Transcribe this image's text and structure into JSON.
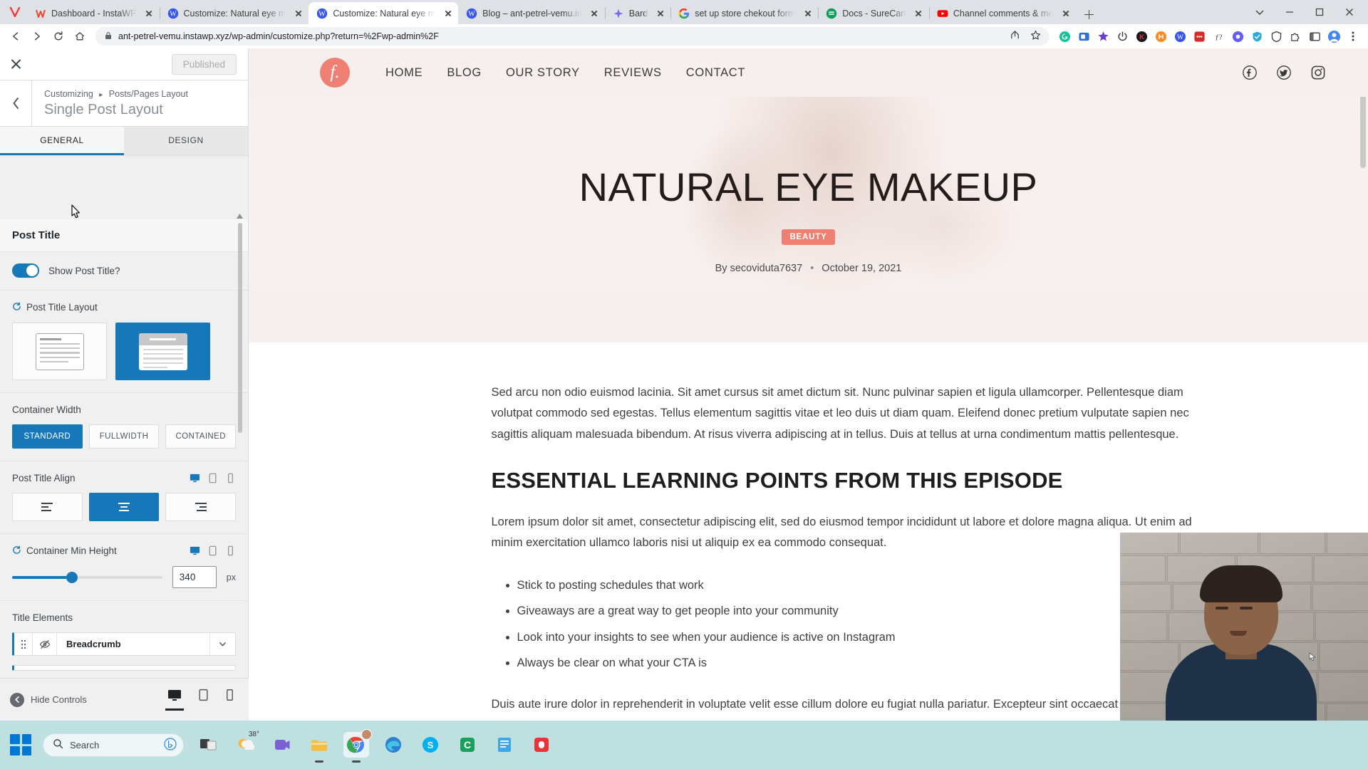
{
  "browser": {
    "tabs": [
      {
        "title": "Dashboard - InstaWP",
        "favicon": "instawp-icon",
        "active": false
      },
      {
        "title": "Customize: Natural eye m",
        "favicon": "wordpress-icon",
        "active": false
      },
      {
        "title": "Customize: Natural eye m",
        "favicon": "wordpress-icon",
        "active": true
      },
      {
        "title": "Blog – ant-petrel-vemu.in",
        "favicon": "wordpress-icon",
        "active": false
      },
      {
        "title": "Bard",
        "favicon": "bard-icon",
        "active": false
      },
      {
        "title": "set up store chekout form",
        "favicon": "google-icon",
        "active": false
      },
      {
        "title": "Docs - SureCart",
        "favicon": "surecart-icon",
        "active": false
      },
      {
        "title": "Channel comments & me",
        "favicon": "youtube-icon",
        "active": false
      }
    ],
    "new_tab_label": "+",
    "window_controls": {
      "minimize": "—",
      "maximize": "□",
      "close": "✕"
    },
    "url": "ant-petrel-vemu.instawp.xyz/wp-admin/customize.php?return=%2Fwp-admin%2F",
    "nav_icons": [
      "back-icon",
      "forward-icon",
      "reload-icon",
      "home-icon"
    ],
    "omnibox_icons": [
      "lock-icon",
      "share-icon",
      "bookmark-star-icon"
    ],
    "extension_icons": [
      "grammarly-icon",
      "pocket-icon",
      "colorzilla-icon",
      "power-icon",
      "keeper-icon",
      "honey-icon",
      "wp-icon",
      "lastpass-icon",
      "js-icon",
      "loom-icon",
      "shield-icon",
      "puzzle-icon",
      "sidebar-icon",
      "profile-avatar",
      "menu-icon"
    ]
  },
  "customizer": {
    "close_label": "✕",
    "publish_label": "Published",
    "back_label": "‹",
    "breadcrumb_root": "Customizing",
    "breadcrumb_sep": "▸",
    "breadcrumb_parent": "Posts/Pages Layout",
    "panel_title": "Single Post Layout",
    "tabs": [
      {
        "label": "GENERAL",
        "active": true
      },
      {
        "label": "DESIGN",
        "active": false
      }
    ],
    "section_title": "Post Title",
    "show_post_title": {
      "label": "Show Post Title?",
      "value": true
    },
    "post_title_layout": {
      "label": "Post Title Layout",
      "options": [
        "layout-plain",
        "layout-banner"
      ],
      "selected_index": 1
    },
    "container_width": {
      "label": "Container Width",
      "options": [
        "STANDARD",
        "FULLWIDTH",
        "CONTAINED"
      ],
      "selected_index": 0
    },
    "post_title_align": {
      "label": "Post Title Align",
      "options": [
        "align-left",
        "align-center",
        "align-right"
      ],
      "selected_index": 1,
      "devices": [
        "desktop-icon",
        "tablet-icon",
        "mobile-icon"
      ],
      "active_device": 0
    },
    "container_min_height": {
      "label": "Container Min Height",
      "value": "340",
      "unit": "px",
      "slider_percent": 40,
      "devices": [
        "desktop-icon",
        "tablet-icon",
        "mobile-icon"
      ],
      "active_device": 0
    },
    "title_elements": {
      "label": "Title Elements",
      "items": [
        {
          "name": "Breadcrumb",
          "visibility_icon": "eye-off-icon",
          "grip_icon": "drag-handle-icon",
          "chevron": "chevron-down-icon"
        }
      ]
    },
    "footer": {
      "hide_controls_label": "Hide Controls",
      "devices": [
        "desktop-icon",
        "tablet-icon",
        "mobile-icon"
      ],
      "active_device": 0
    },
    "accent_color": "#1678b9"
  },
  "site": {
    "logo_text": "f.",
    "logo_color": "#ee7f72",
    "nav": [
      "HOME",
      "BLOG",
      "OUR STORY",
      "REVIEWS",
      "CONTACT"
    ],
    "social": [
      "facebook-icon",
      "twitter-icon",
      "instagram-icon"
    ],
    "hero": {
      "title": "NATURAL EYE MAKEUP",
      "category": "BEAUTY",
      "category_color": "#ee7f72",
      "author_prefix": "By",
      "author": "secoviduta7637",
      "separator": "•",
      "date": "October 19, 2021",
      "background_color": "#f7efed"
    },
    "article": {
      "intro": "Sed arcu non odio euismod lacinia. Sit amet cursus sit amet dictum sit. Nunc pulvinar sapien et ligula ullamcorper. Pellentesque diam volutpat commodo sed egestas. Tellus elementum sagittis vitae et leo duis ut diam quam. Eleifend donec pretium vulputate sapien nec sagittis aliquam malesuada bibendum. At risus viverra adipiscing at in tellus. Duis at tellus at urna condimentum mattis pellentesque.",
      "heading": "ESSENTIAL LEARNING POINTS FROM THIS EPISODE",
      "paragraph2": "Lorem ipsum dolor sit amet, consectetur adipiscing elit, sed do eiusmod tempor incididunt ut labore et dolore magna aliqua. Ut enim ad minim exercitation ullamco laboris nisi ut aliquip ex ea commodo consequat.",
      "bullets": [
        "Stick to posting schedules that work",
        "Giveaways are a great way to get people into your community",
        "Look into your insights to see when your audience is active on Instagram",
        "Always be clear on what your CTA is"
      ],
      "paragraph3": "Duis aute irure dolor in reprehenderit in voluptate velit esse cillum dolore eu fugiat nulla pariatur. Excepteur sint occaecat cupidatat non proid"
    }
  },
  "taskbar": {
    "start_label": "start-icon",
    "search_placeholder": "Search",
    "search_icons": [
      "search-icon",
      "bing-chat-icon"
    ],
    "weather_temp": "38°",
    "apps": [
      "task-view-icon",
      "weather-icon",
      "teams-icon",
      "file-explorer-icon",
      "chrome-icon",
      "edge-icon",
      "skype-icon",
      "calculator-icon",
      "notepad-icon",
      "recorder-icon"
    ]
  }
}
